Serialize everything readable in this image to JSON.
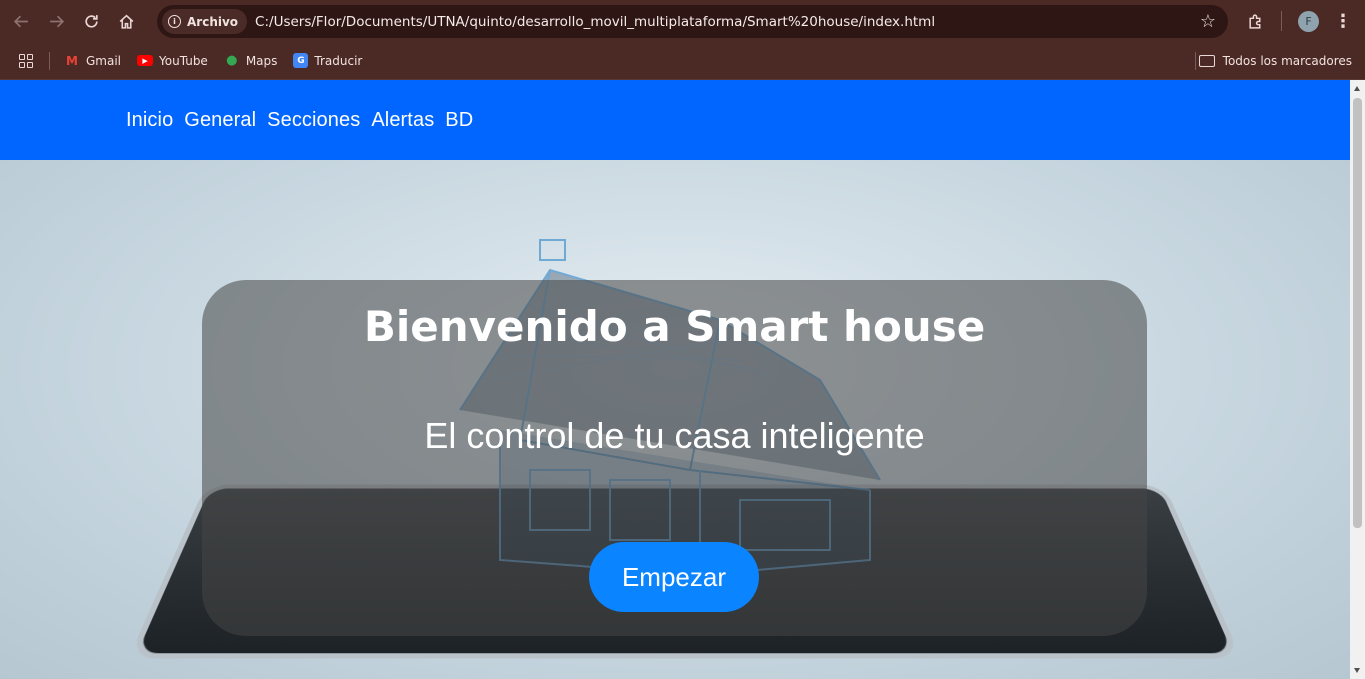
{
  "browser": {
    "chip_label": "Archivo",
    "url": "C:/Users/Flor/Documents/UTNA/quinto/desarrollo_movil_multiplataforma/Smart%20house/index.html",
    "profile_initial": "F",
    "bookmarks": [
      {
        "label": "Gmail",
        "icon": "gmail-icon"
      },
      {
        "label": "YouTube",
        "icon": "youtube-icon"
      },
      {
        "label": "Maps",
        "icon": "maps-icon"
      },
      {
        "label": "Traducir",
        "icon": "translate-icon"
      }
    ],
    "all_bookmarks_label": "Todos los marcadores"
  },
  "nav": {
    "items": [
      "Inicio",
      "General",
      "Secciones",
      "Alertas",
      "BD"
    ]
  },
  "hero": {
    "title": "Bienvenido a Smart house",
    "subtitle": "El control de tu casa inteligente",
    "cta_label": "Empezar"
  },
  "colors": {
    "nav_bg": "#0066ff",
    "cta_bg": "#0a84ff",
    "chrome_bg": "#4b2925"
  }
}
